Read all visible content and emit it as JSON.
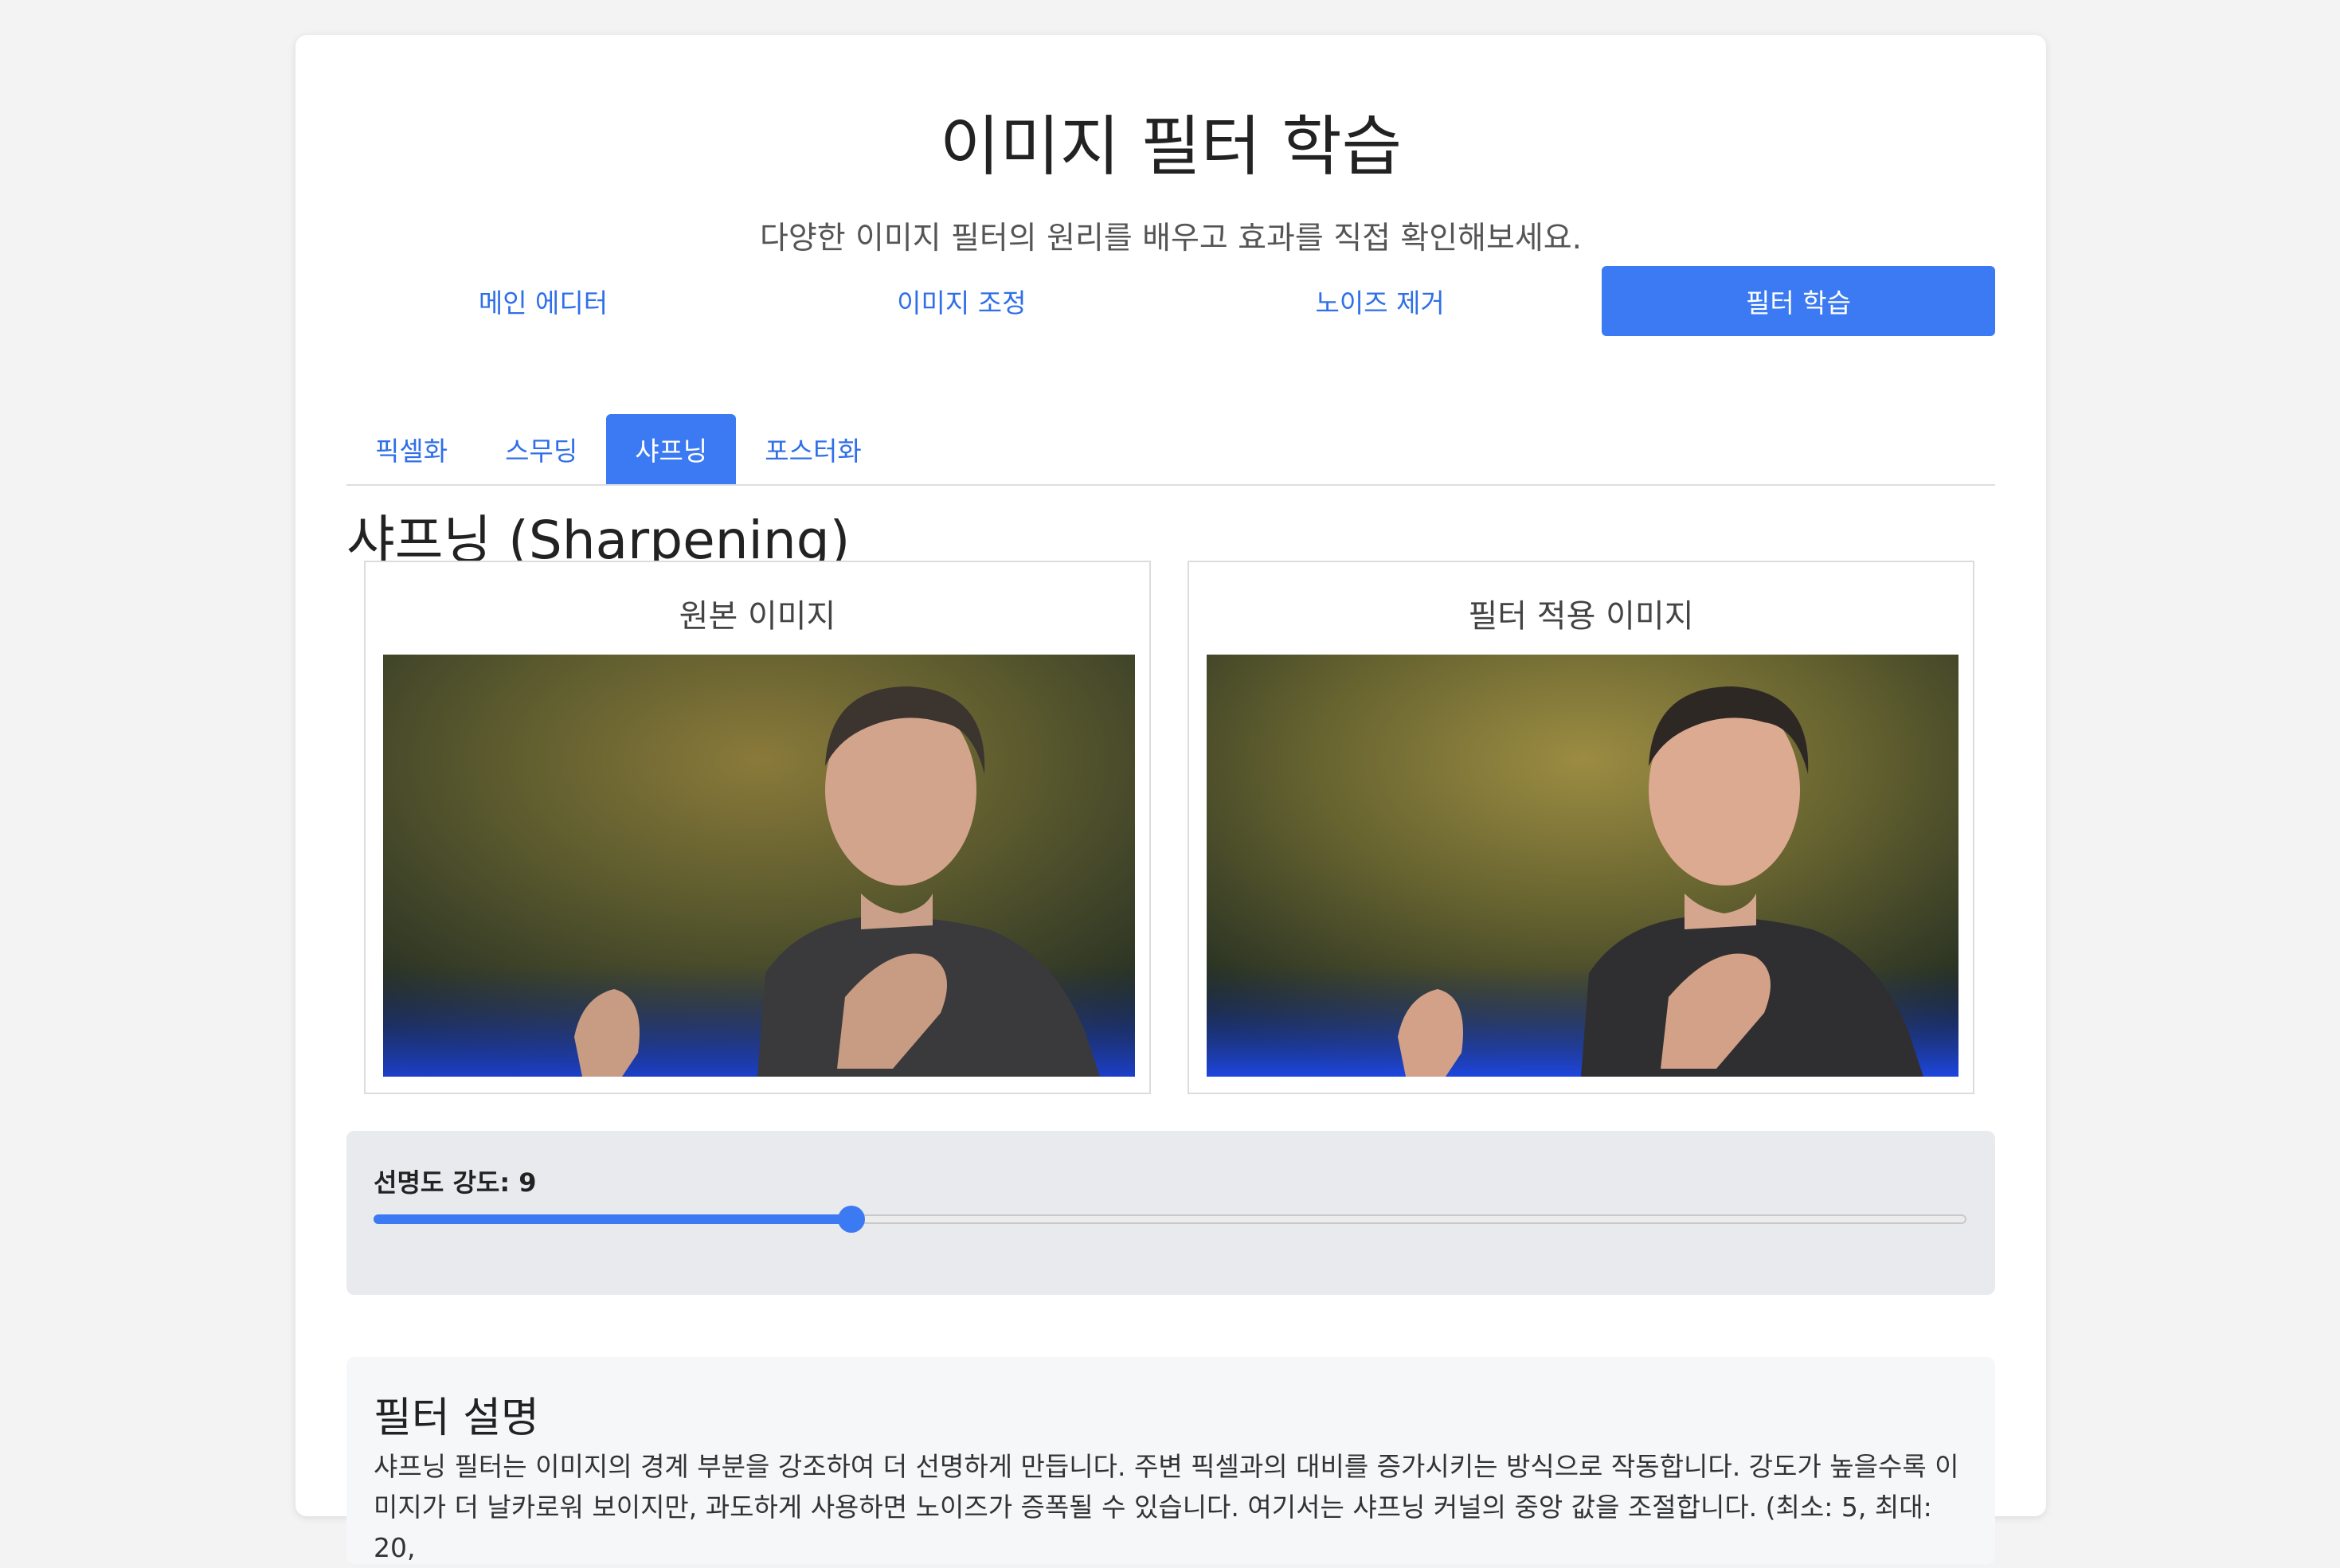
{
  "header": {
    "title": "이미지 필터 학습",
    "subtitle": "다양한 이미지 필터의 원리를 배우고 효과를 직접 확인해보세요."
  },
  "main_tabs": [
    {
      "label": "메인 에디터",
      "active": false
    },
    {
      "label": "이미지 조정",
      "active": false
    },
    {
      "label": "노이즈 제거",
      "active": false
    },
    {
      "label": "필터 학습",
      "active": true
    }
  ],
  "filter_tabs": [
    {
      "label": "픽셀화",
      "active": false
    },
    {
      "label": "스무딩",
      "active": false
    },
    {
      "label": "샤프닝",
      "active": true
    },
    {
      "label": "포스터화",
      "active": false
    }
  ],
  "section": {
    "heading": "샤프닝 (Sharpening)"
  },
  "panels": {
    "original_title": "원본 이미지",
    "filtered_title": "필터 적용 이미지"
  },
  "slider": {
    "label": "선명도 강도: 9",
    "value": 9,
    "min": 5,
    "max": 20
  },
  "explanation": {
    "title": "필터 설명",
    "text": "샤프닝 필터는 이미지의 경계 부분을 강조하여 더 선명하게 만듭니다. 주변 픽셀과의 대비를 증가시키는 방식으로 작동합니다. 강도가 높을수록 이미지가 더 날카로워 보이지만, 과도하게 사용하면 노이즈가 증폭될 수 있습니다. 여기서는 샤프닝 커널의 중앙 값을 조절합니다. (최소: 5, 최대: 20,"
  },
  "colors": {
    "accent": "#3b7af2",
    "link": "#2f6fe8",
    "background": "#f3f3f3"
  }
}
